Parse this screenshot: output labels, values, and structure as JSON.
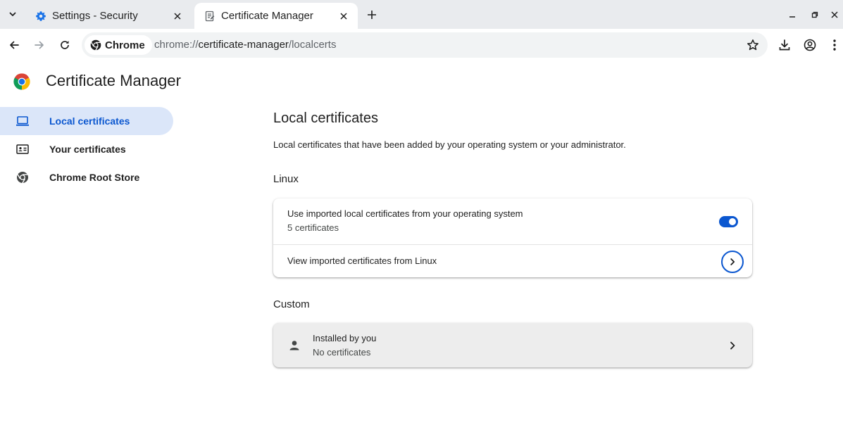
{
  "tabs": [
    {
      "title": "Settings - Security",
      "icon": "gear-icon",
      "active": false
    },
    {
      "title": "Certificate Manager",
      "icon": "certificate-icon",
      "active": true
    }
  ],
  "toolbar": {
    "chip_label": "Chrome",
    "url_scheme": "chrome://",
    "url_host": "certificate-manager",
    "url_path": "/localcerts"
  },
  "page": {
    "title": "Certificate Manager"
  },
  "sidebar": {
    "items": [
      {
        "label": "Local certificates",
        "icon": "laptop-icon",
        "selected": true
      },
      {
        "label": "Your certificates",
        "icon": "id-card-icon",
        "selected": false
      },
      {
        "label": "Chrome Root Store",
        "icon": "chrome-icon",
        "selected": false
      }
    ]
  },
  "main": {
    "title": "Local certificates",
    "description": "Local certificates that have been added by your operating system or your administrator.",
    "linux": {
      "heading": "Linux",
      "use_imported_label": "Use imported local certificates from your operating system",
      "use_imported_count": "5 certificates",
      "use_imported_enabled": true,
      "view_imported_label": "View imported certificates from Linux"
    },
    "custom": {
      "heading": "Custom",
      "installed_label": "Installed by you",
      "installed_count": "No certificates"
    }
  },
  "colors": {
    "accent": "#0b57d0",
    "nav_selected_bg": "#dbe6f9",
    "tabstrip_bg": "#e9ebee"
  }
}
